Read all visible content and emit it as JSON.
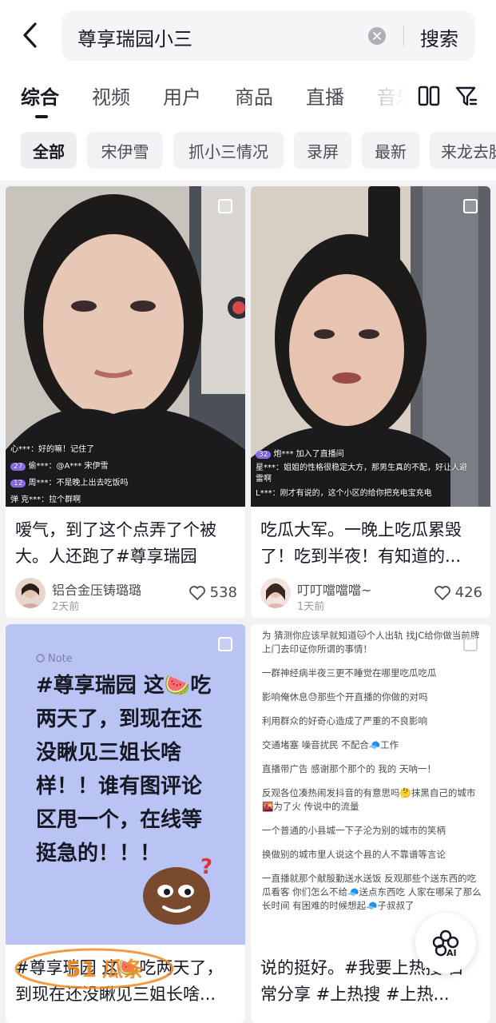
{
  "search": {
    "query": "尊享瑞园小三",
    "button": "搜索"
  },
  "tabs": [
    {
      "label": "综合",
      "active": true
    },
    {
      "label": "视频",
      "active": false
    },
    {
      "label": "用户",
      "active": false
    },
    {
      "label": "商品",
      "active": false
    },
    {
      "label": "直播",
      "active": false
    },
    {
      "label": "音乐",
      "active": false
    }
  ],
  "tab_icons": [
    "dual-column-icon",
    "filter-icon"
  ],
  "chips": [
    {
      "label": "全部",
      "active": true
    },
    {
      "label": "宋伊雪",
      "active": false
    },
    {
      "label": "抓小三情况",
      "active": false
    },
    {
      "label": "录屏",
      "active": false
    },
    {
      "label": "最新",
      "active": false
    },
    {
      "label": "来龙去脉",
      "active": false
    }
  ],
  "cards": [
    {
      "title": "嗳气，到了这个点弄了个被大。人还跑了#尊享瑞园",
      "author": "铝合金压铸璐璐",
      "time": "2天前",
      "likes": "538",
      "overlays": [
        {
          "level": "",
          "text": "心***：好的嘛！记住了"
        },
        {
          "level": "27",
          "text": "偷***：@A*** 宋伊雪"
        },
        {
          "level": "12",
          "text": "周***：不是晚上出去吃饭吗"
        },
        {
          "level": "",
          "text": "弹  克***：拉个群啊"
        }
      ]
    },
    {
      "title": "吃瓜大军。一晚上吃瓜累毁了！吃到半夜！有知道的...",
      "author": "叮叮噹噹噹~",
      "time": "1天前",
      "likes": "426",
      "overlays": [
        {
          "level": "32",
          "text": "炮*** 加入了直播间"
        },
        {
          "level": "",
          "text": "星***：姐姐的性格很稳定大方，那男生真的不配，好让人避雷啊"
        },
        {
          "level": "",
          "text": "L***：刚才有说的，这个小区的给你把充电宝充电"
        }
      ]
    },
    {
      "title": "#尊享瑞园 这🍉吃两天了，到现在还没瞅见三姐长啥...",
      "note_tag": "Note",
      "note_lines": [
        "#尊享瑞园 这🍉吃",
        "两天了，到现在还",
        "没瞅见三姐长啥",
        "样！！谁有图评论",
        "区甩一个，在线等",
        "挺急的！！！"
      ]
    },
    {
      "title": "说的挺好。#我要上热搜 日常分享 #上热搜 #上热...",
      "text_lines": [
        "为 猜测你应该早就知道🐱个人出轨 找JC给你做当前牌 上门去印证你所谓的事情！",
        "一群神经病半夜三更不睡觉在哪里吃瓜吃瓜",
        "影响俺休息😓那些个开直播的你做的对吗",
        "利用群众的好奇心造成了严重的不良影响",
        "交通堵塞 噪音扰民 不配合🧢工作",
        "直播带广告 感谢那个那个的 我的 天呐一！",
        "反观各位凑热闹发抖音的有意思吗🤔抹黑自己的城市 🌇为了火 传说中的流量",
        "一个普通的小县城一下子沦为别的城市的笑柄",
        "换做别的城市里人说这个县的人不靠谱等言论",
        "一直播就那个献殷勤送水送饭 反观那些个送东西的吃瓜看客 你们怎么不给🧢送点东西吃 人家在哪呆了那么长时间 有困难的时候想起🧢子叔叔了"
      ]
    }
  ],
  "ai_button": "AI",
  "watermark": "51瓜条"
}
